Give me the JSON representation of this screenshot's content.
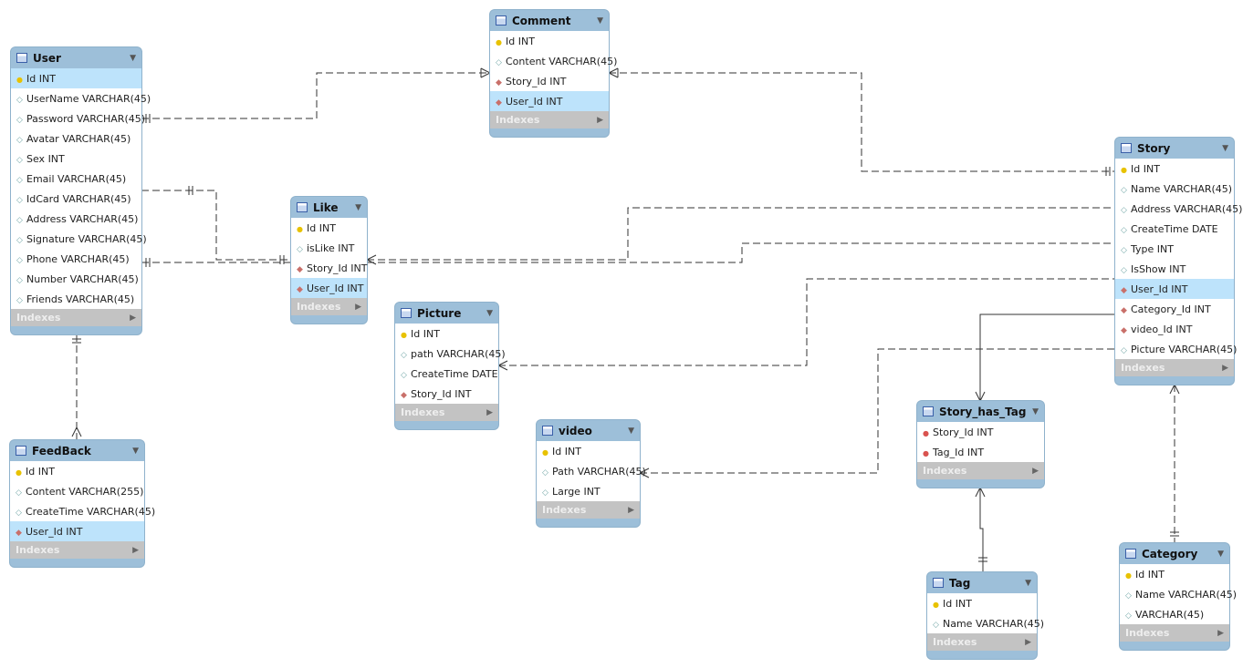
{
  "tables": [
    {
      "id": "user",
      "name": "User",
      "indexes_label": "Indexes",
      "columns": [
        {
          "label": "Id INT",
          "kind": "pk",
          "selected": true
        },
        {
          "label": "UserName VARCHAR(45)",
          "kind": "col"
        },
        {
          "label": "Password VARCHAR(45)",
          "kind": "col"
        },
        {
          "label": "Avatar VARCHAR(45)",
          "kind": "col"
        },
        {
          "label": "Sex INT",
          "kind": "col"
        },
        {
          "label": "Email VARCHAR(45)",
          "kind": "col"
        },
        {
          "label": "IdCard VARCHAR(45)",
          "kind": "col"
        },
        {
          "label": "Address VARCHAR(45)",
          "kind": "col"
        },
        {
          "label": "Signature VARCHAR(45)",
          "kind": "col"
        },
        {
          "label": "Phone VARCHAR(45)",
          "kind": "col"
        },
        {
          "label": "Number VARCHAR(45)",
          "kind": "col"
        },
        {
          "label": "Friends VARCHAR(45)",
          "kind": "col"
        }
      ]
    },
    {
      "id": "comment",
      "name": "Comment",
      "indexes_label": "Indexes",
      "columns": [
        {
          "label": "Id INT",
          "kind": "pk"
        },
        {
          "label": "Content VARCHAR(45)",
          "kind": "col"
        },
        {
          "label": "Story_Id INT",
          "kind": "fk"
        },
        {
          "label": "User_Id INT",
          "kind": "fk",
          "selected": true
        }
      ]
    },
    {
      "id": "like",
      "name": "Like",
      "indexes_label": "Indexes",
      "columns": [
        {
          "label": "Id INT",
          "kind": "pk"
        },
        {
          "label": "isLike INT",
          "kind": "col"
        },
        {
          "label": "Story_Id INT",
          "kind": "fk"
        },
        {
          "label": "User_Id INT",
          "kind": "fk",
          "selected": true
        }
      ]
    },
    {
      "id": "picture",
      "name": "Picture",
      "indexes_label": "Indexes",
      "columns": [
        {
          "label": "Id INT",
          "kind": "pk"
        },
        {
          "label": "path VARCHAR(45)",
          "kind": "col"
        },
        {
          "label": "CreateTime DATE",
          "kind": "col"
        },
        {
          "label": "Story_Id INT",
          "kind": "fk"
        }
      ]
    },
    {
      "id": "video",
      "name": "video",
      "indexes_label": "Indexes",
      "columns": [
        {
          "label": "Id INT",
          "kind": "pk"
        },
        {
          "label": "Path VARCHAR(45)",
          "kind": "col"
        },
        {
          "label": "Large INT",
          "kind": "col"
        }
      ]
    },
    {
      "id": "feedback",
      "name": "FeedBack",
      "indexes_label": "Indexes",
      "columns": [
        {
          "label": "Id INT",
          "kind": "pk"
        },
        {
          "label": "Content VARCHAR(255)",
          "kind": "col"
        },
        {
          "label": "CreateTime VARCHAR(45)",
          "kind": "col"
        },
        {
          "label": "User_Id INT",
          "kind": "fk",
          "selected": true
        }
      ]
    },
    {
      "id": "story",
      "name": "Story",
      "indexes_label": "Indexes",
      "columns": [
        {
          "label": "Id INT",
          "kind": "pk"
        },
        {
          "label": "Name VARCHAR(45)",
          "kind": "col"
        },
        {
          "label": "Address VARCHAR(45)",
          "kind": "col"
        },
        {
          "label": "CreateTime DATE",
          "kind": "col"
        },
        {
          "label": "Type INT",
          "kind": "col"
        },
        {
          "label": "IsShow INT",
          "kind": "col"
        },
        {
          "label": "User_Id INT",
          "kind": "fk",
          "selected": true
        },
        {
          "label": "Category_Id INT",
          "kind": "fk"
        },
        {
          "label": "video_Id INT",
          "kind": "fk"
        },
        {
          "label": "Picture VARCHAR(45)",
          "kind": "col"
        }
      ]
    },
    {
      "id": "storytag",
      "name": "Story_has_Tag",
      "indexes_label": "Indexes",
      "columns": [
        {
          "label": "Story_Id INT",
          "kind": "pkfk"
        },
        {
          "label": "Tag_Id INT",
          "kind": "pkfk"
        }
      ]
    },
    {
      "id": "tag",
      "name": "Tag",
      "indexes_label": "Indexes",
      "columns": [
        {
          "label": "Id INT",
          "kind": "pk"
        },
        {
          "label": "Name VARCHAR(45)",
          "kind": "col"
        }
      ]
    },
    {
      "id": "category",
      "name": "Category",
      "indexes_label": "Indexes",
      "columns": [
        {
          "label": "Id INT",
          "kind": "pk"
        },
        {
          "label": "Name VARCHAR(45)",
          "kind": "col"
        },
        {
          "label": " VARCHAR(45)",
          "kind": "col"
        }
      ]
    }
  ],
  "colors": {
    "header": "#9dbfd9",
    "selected_row": "#bde3fb",
    "indexes_bar": "#c3c3c3",
    "line": "#333333"
  }
}
